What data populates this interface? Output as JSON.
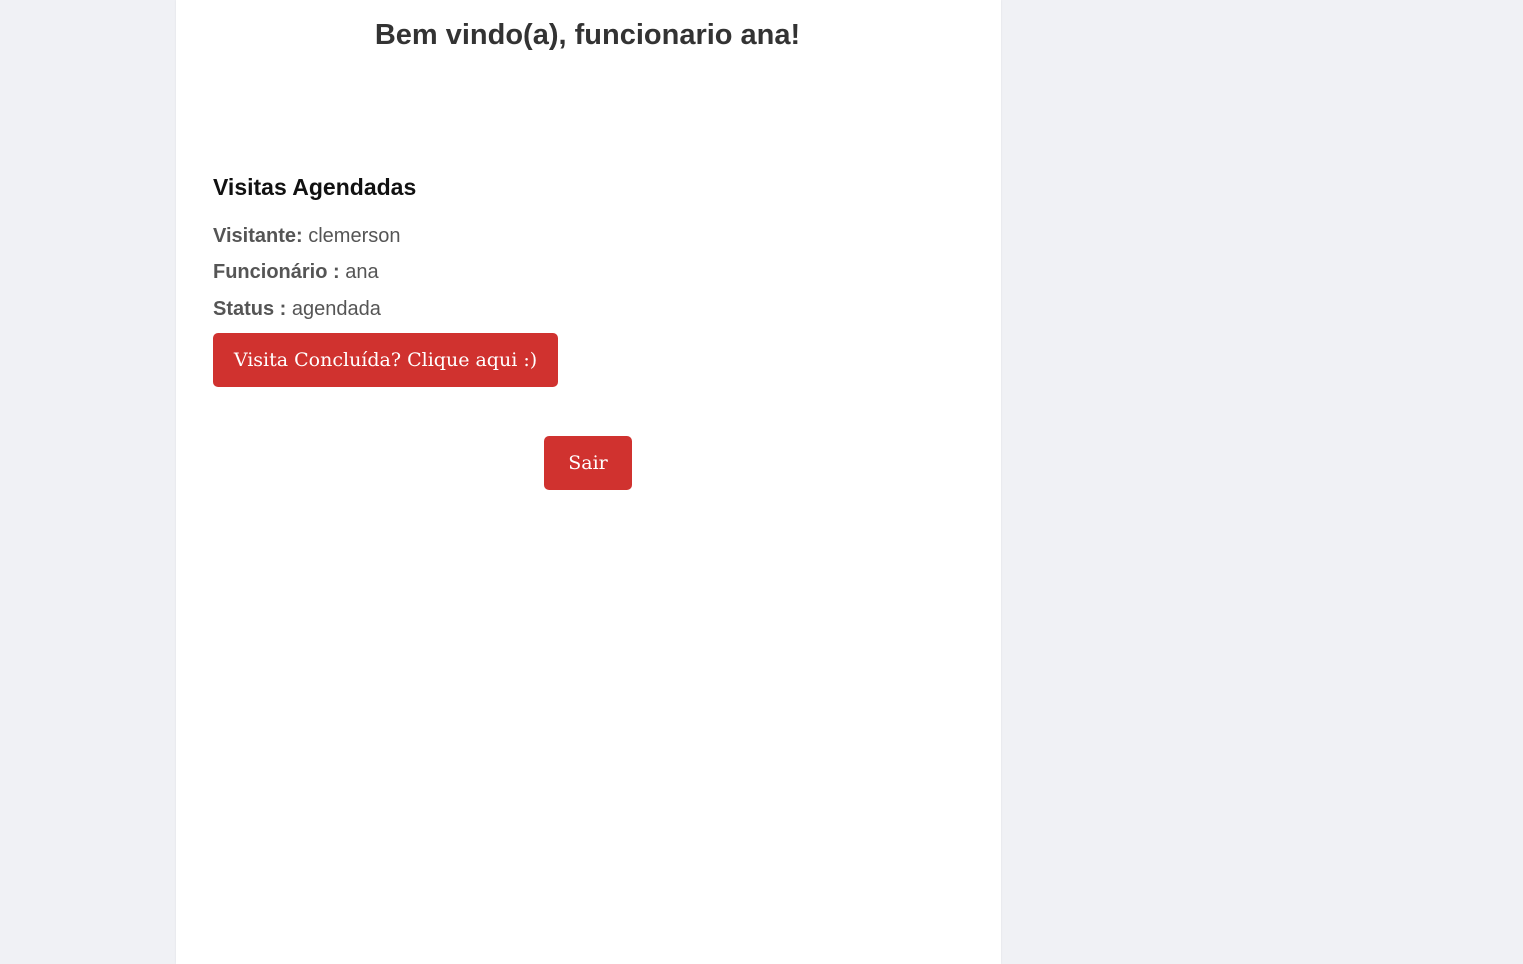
{
  "header": {
    "welcome": "Bem vindo(a), funcionario ana!"
  },
  "visits": {
    "title": "Visitas Agendadas",
    "items": [
      {
        "visitor_label": "Visitante:",
        "visitor_value": "clemerson",
        "employee_label": "Funcionário :",
        "employee_value": "ana",
        "status_label": "Status :",
        "status_value": "agendada",
        "complete_button": "Visita Concluída? Clique aqui :)"
      }
    ]
  },
  "actions": {
    "logout": "Sair"
  },
  "colors": {
    "background": "#f0f1f5",
    "card": "#ffffff",
    "button": "#d0322f",
    "button_text": "#ffffff"
  }
}
